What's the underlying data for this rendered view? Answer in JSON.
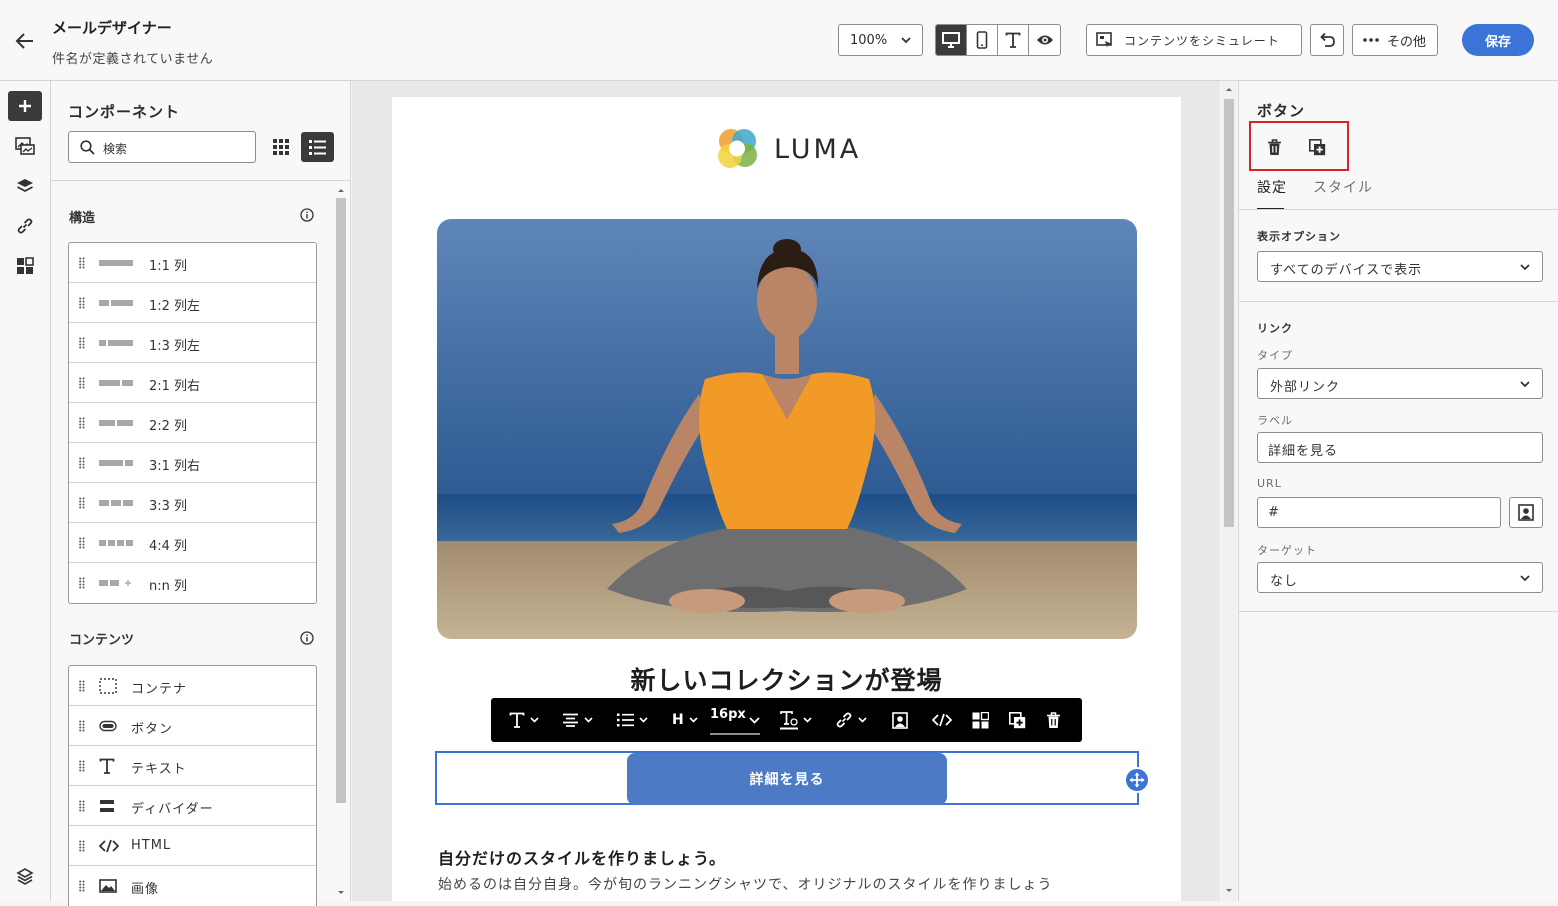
{
  "header": {
    "title": "メールデザイナー",
    "subtitle": "件名が定義されていません",
    "zoom_value": "100%",
    "simulate_label": "コンテンツをシミュレート",
    "more_label": "その他",
    "save_label": "保存"
  },
  "components": {
    "heading": "コンポーネント",
    "search_value": "検索",
    "structure_heading": "構造",
    "structure_items": [
      {
        "label": "1:1 列"
      },
      {
        "label": "1:2 列左"
      },
      {
        "label": "1:3 列左"
      },
      {
        "label": "2:1 列右"
      },
      {
        "label": "2:2 列"
      },
      {
        "label": "3:1 列右"
      },
      {
        "label": "3:3 列"
      },
      {
        "label": "4:4 列"
      },
      {
        "label": "n:n 列"
      }
    ],
    "content_heading": "コンテンツ",
    "content_items": [
      {
        "label": "コンテナ"
      },
      {
        "label": "ボタン"
      },
      {
        "label": "テキスト"
      },
      {
        "label": "ディバイダー"
      },
      {
        "label": "HTML"
      },
      {
        "label": "画像"
      }
    ]
  },
  "email": {
    "logo_text": "LUMA",
    "headline": "新しいコレクションが登場",
    "cta_label": "詳細を見る",
    "subheading": "自分だけのスタイルを作りましょう。",
    "body_text": "始めるのは自分自身。今が旬のランニングシャツで、オリジナルのスタイルを作りましょう"
  },
  "toolbar": {
    "heading_label": "H",
    "font_size": "16px"
  },
  "properties": {
    "title": "ボタン",
    "tab_settings": "設定",
    "tab_style": "スタイル",
    "display_options_label": "表示オプション",
    "display_options_value": "すべてのデバイスで表示",
    "link_section_label": "リンク",
    "type_label": "タイプ",
    "type_value": "外部リンク",
    "label_label": "ラベル",
    "label_value": "詳細を見る",
    "url_label": "URL",
    "url_value": "#",
    "target_label": "ターゲット",
    "target_value": "なし"
  },
  "colors": {
    "accent": "#3b74d6",
    "button_fill": "#4d7ac5",
    "highlight_box": "#d8232a"
  }
}
